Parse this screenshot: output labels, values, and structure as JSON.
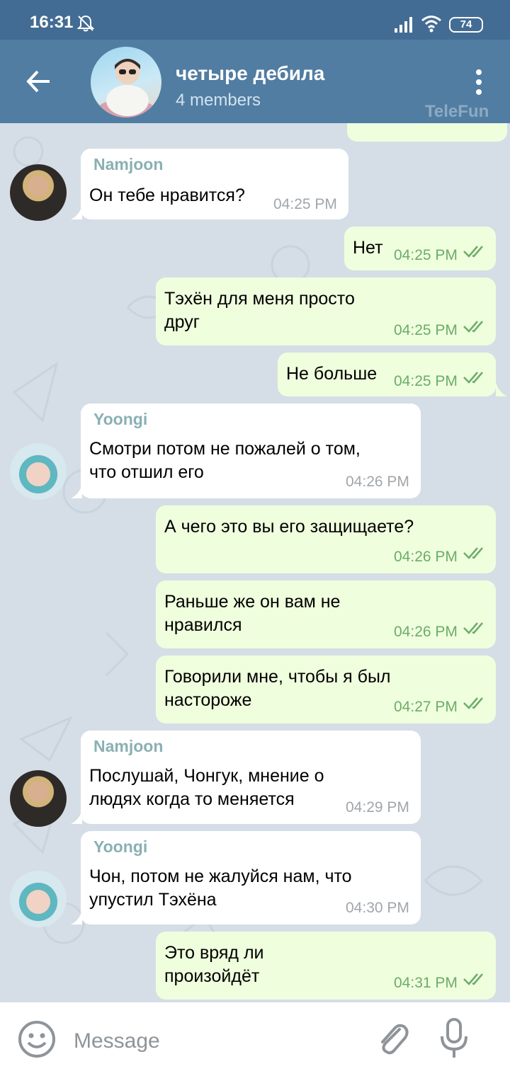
{
  "status_bar": {
    "time": "16:31",
    "battery": "74",
    "icons": [
      "bell-off-icon",
      "signal-icon",
      "wifi-icon",
      "battery-icon"
    ]
  },
  "header": {
    "title": "четыре дебила",
    "subtitle": "4 members",
    "watermark": "TeleFun",
    "icons": [
      "back-arrow-icon",
      "more-vertical-icon"
    ]
  },
  "colors": {
    "status_bar": "#436c94",
    "app_bar": "#517da2",
    "chat_background": "#d5dee6",
    "incoming_bubble": "#ffffff",
    "outgoing_bubble": "#effedd",
    "sender_name": "#8ab0b3",
    "read_check": "#6cac6a"
  },
  "messages": [
    {
      "direction": "in",
      "sender": "Namjoon",
      "text": "Он тебе нравится?",
      "time": "04:25 PM"
    },
    {
      "direction": "out",
      "text": "Нет",
      "time": "04:25 PM",
      "read": true
    },
    {
      "direction": "out",
      "text": "Тэхён для меня просто\nдруг",
      "time": "04:25 PM",
      "read": true
    },
    {
      "direction": "out",
      "text": "Не больше",
      "time": "04:25 PM",
      "read": true
    },
    {
      "direction": "in",
      "sender": "Yoongi",
      "text": "Смотри потом не пожалей о том,\nчто отшил его",
      "time": "04:26 PM"
    },
    {
      "direction": "out",
      "text": "А чего это вы его защищаете?",
      "time": "04:26 PM",
      "read": true
    },
    {
      "direction": "out",
      "text": "Раньше же он вам не\nнравился",
      "time": "04:26 PM",
      "read": true
    },
    {
      "direction": "out",
      "text": "Говорили мне, чтобы я был\nнастороже",
      "time": "04:27 PM",
      "read": true
    },
    {
      "direction": "in",
      "sender": "Namjoon",
      "text": "Послушай, Чонгук, мнение о\nлюдях когда то меняется",
      "time": "04:29 PM"
    },
    {
      "direction": "in",
      "sender": "Yoongi",
      "text": "Чон, потом не жалуйся нам, что\nупустил Тэхёна",
      "time": "04:30 PM"
    },
    {
      "direction": "out",
      "text": "Это вряд ли\nпроизойдёт",
      "time": "04:31 PM",
      "read": true
    }
  ],
  "input": {
    "placeholder": "Message",
    "icons": [
      "emoji-icon",
      "attach-icon",
      "microphone-icon"
    ]
  }
}
